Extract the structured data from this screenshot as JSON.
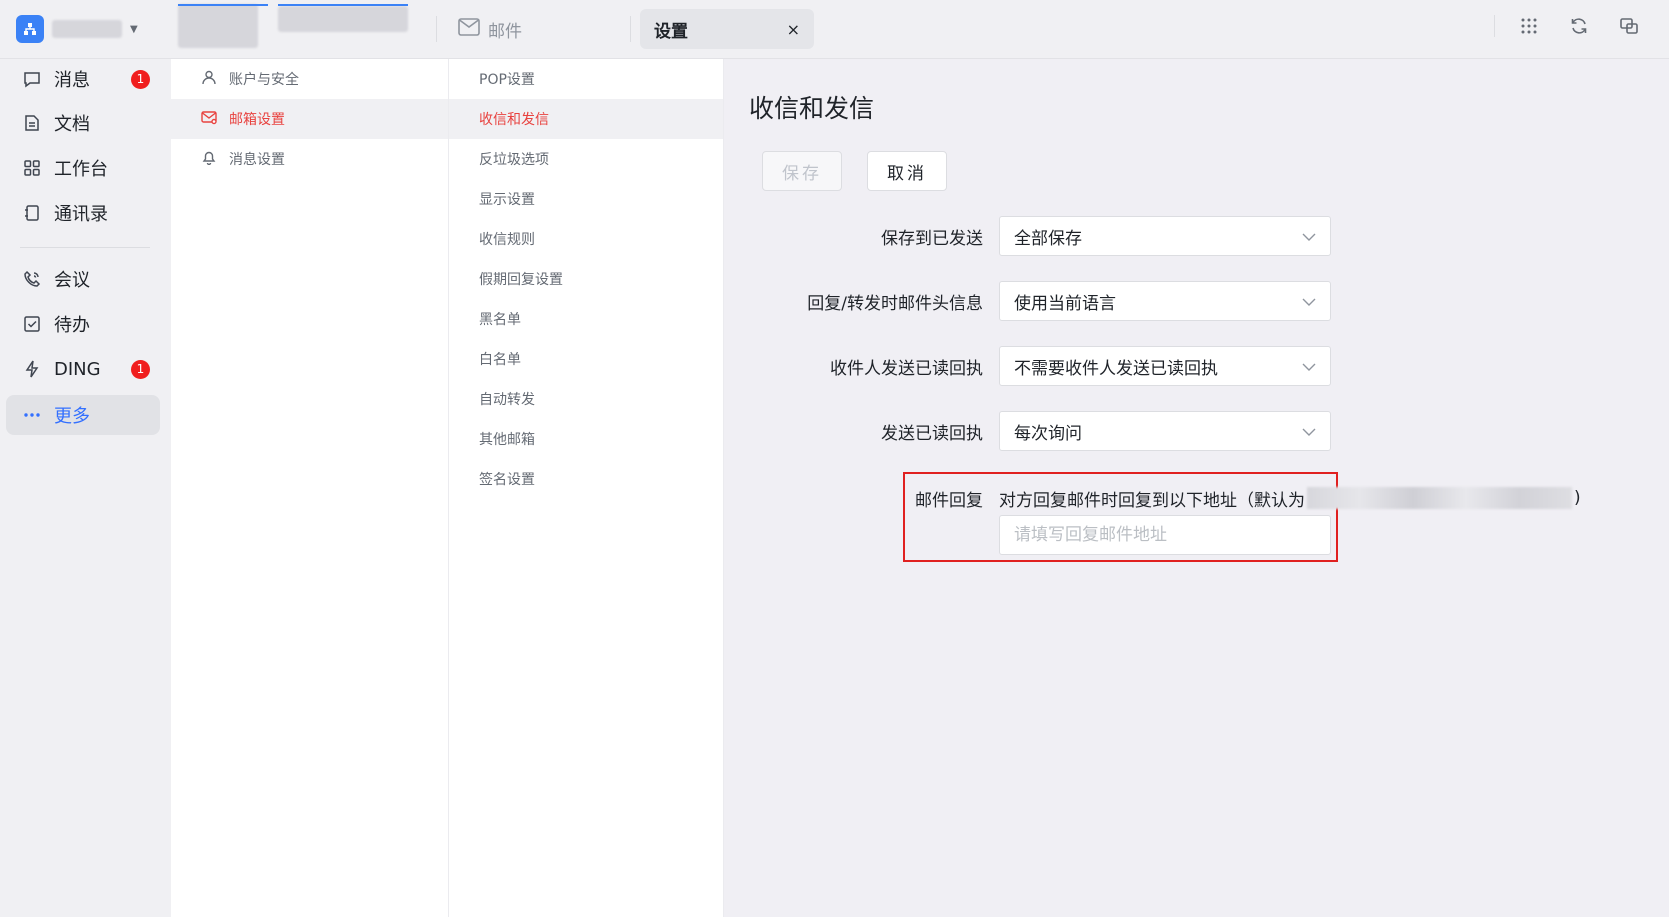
{
  "colors": {
    "accent": "#3370ff",
    "active_red": "#e8423f",
    "badge_red": "#f01e1e",
    "highlight_box": "#e02020"
  },
  "topbar": {
    "tabs": [
      {
        "label": "邮件",
        "icon": "mail-icon"
      },
      {
        "label": "设置",
        "close": "×"
      }
    ],
    "actions": [
      "apps-grid-icon",
      "refresh-icon",
      "window-switch-icon"
    ]
  },
  "leftnav": {
    "items": [
      {
        "label": "消息",
        "icon": "message-icon",
        "badge": "1"
      },
      {
        "label": "文档",
        "icon": "document-icon"
      },
      {
        "label": "工作台",
        "icon": "workbench-icon"
      },
      {
        "label": "通讯录",
        "icon": "contacts-icon"
      },
      {
        "label": "会议",
        "icon": "meeting-icon"
      },
      {
        "label": "待办",
        "icon": "todo-icon"
      },
      {
        "label": "DING",
        "icon": "ding-icon",
        "badge": "1"
      },
      {
        "label": "更多",
        "icon": "more-icon",
        "active": true
      }
    ]
  },
  "settings_nav": {
    "items": [
      {
        "label": "账户与安全",
        "icon": "user-icon"
      },
      {
        "label": "邮箱设置",
        "icon": "mail-settings-icon",
        "active": true
      },
      {
        "label": "消息设置",
        "icon": "bell-icon"
      }
    ]
  },
  "mail_settings_nav": {
    "items": [
      "POP设置",
      "收信和发信",
      "反垃圾选项",
      "显示设置",
      "收信规则",
      "假期回复设置",
      "黑名单",
      "白名单",
      "自动转发",
      "其他邮箱",
      "签名设置"
    ],
    "active_index": 1
  },
  "main": {
    "title": "收信和发信",
    "save_label": "保存",
    "cancel_label": "取消",
    "fields": [
      {
        "label": "保存到已发送",
        "value": "全部保存"
      },
      {
        "label": "回复/转发时邮件头信息",
        "value": "使用当前语言"
      },
      {
        "label": "收件人发送已读回执",
        "value": "不需要收件人发送已读回执"
      },
      {
        "label": "发送已读回执",
        "value": "每次询问"
      }
    ],
    "reply": {
      "label": "邮件回复",
      "description": "对方回复邮件时回复到以下地址（默认为",
      "description_end": ")",
      "placeholder": "请填写回复邮件地址"
    }
  }
}
